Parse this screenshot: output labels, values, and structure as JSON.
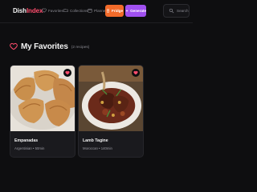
{
  "app": {
    "logo_part1": "Dish",
    "logo_part2": "Index"
  },
  "nav": {
    "favorites": "Favorites",
    "collections": "Collections",
    "planner": "Planner"
  },
  "actions": {
    "fridge": "Fridge",
    "generate": "Generate"
  },
  "search": {
    "placeholder": "Search"
  },
  "page": {
    "title": "My Favorites",
    "count": "(2 recipes)"
  },
  "recipes": [
    {
      "name": "Empanadas",
      "meta": "Argentinian • 50min"
    },
    {
      "name": "Lamb Tagine",
      "meta": "Moroccan • 140min"
    }
  ],
  "colors": {
    "accent_red": "#ff4d6d",
    "fridge": "#f26b2a",
    "generate": "#a050f0",
    "background": "#0e0e10"
  },
  "icons": {
    "favorites": "heart-icon",
    "collections": "folder-icon",
    "planner": "calendar-icon",
    "fridge": "fridge-icon",
    "generate": "sparkle-icon",
    "search": "search-icon"
  }
}
